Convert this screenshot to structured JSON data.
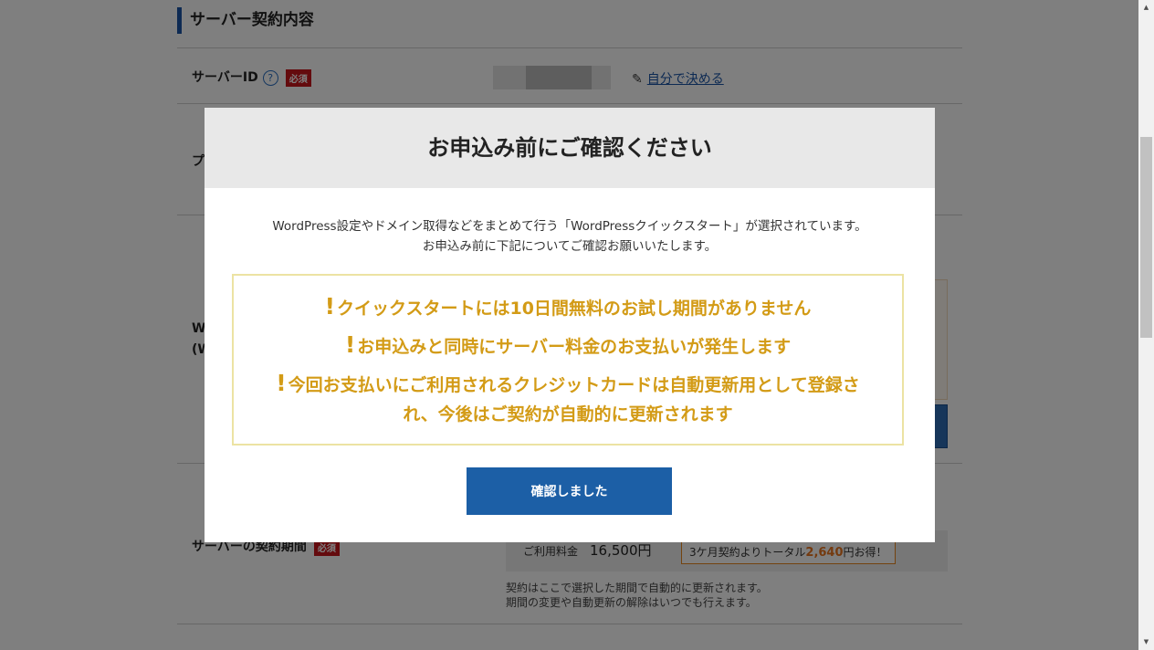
{
  "page": {
    "section_title": "サーバー契約内容",
    "server_id": {
      "label": "サーバーID",
      "help_icon": "?",
      "required": "必須",
      "self_decide_link": "自分で決める"
    },
    "plan_label_partial": "プ",
    "wp_label_partial_1": "W",
    "wp_label_partial_2": "(W",
    "contract_period": {
      "label": "サーバーの契約期間",
      "required": "必須",
      "fee_label": "ご利用料金",
      "fee_amount": "16,500円",
      "promo_prefix": "3ケ月契約よりトータル",
      "promo_amount": "2,640",
      "promo_suffix": "円お得！",
      "note_1": "契約はここで選択した期間で自動的に更新されます。",
      "note_2": "期間の変更や自動更新の解除はいつでも行えます。"
    }
  },
  "modal": {
    "title": "お申込み前にご確認ください",
    "intro_line_1": "WordPress設定やドメイン取得などをまとめて行う「WordPressクイックスタート」が選択されています。",
    "intro_line_2": "お申込み前に下記についてご確認お願いいたします。",
    "warnings": [
      "クイックスタートには10日間無料のお試し期間がありません",
      "お申込みと同時にサーバー料金のお支払いが発生します",
      "今回お支払いにご利用されるクレジットカードは自動更新用として登録さ",
      "れ、今後はご契約が自動的に更新されます"
    ],
    "warning_icon": "!",
    "confirm_button": "確認しました"
  },
  "colors": {
    "accent_blue": "#1c5fa6",
    "warning_gold": "#d39b16",
    "required_red": "#c8161d",
    "overlay": "rgba(0,0,0,0.5)"
  },
  "icons": [
    "help-icon",
    "pencil-icon",
    "exclamation-icon"
  ]
}
